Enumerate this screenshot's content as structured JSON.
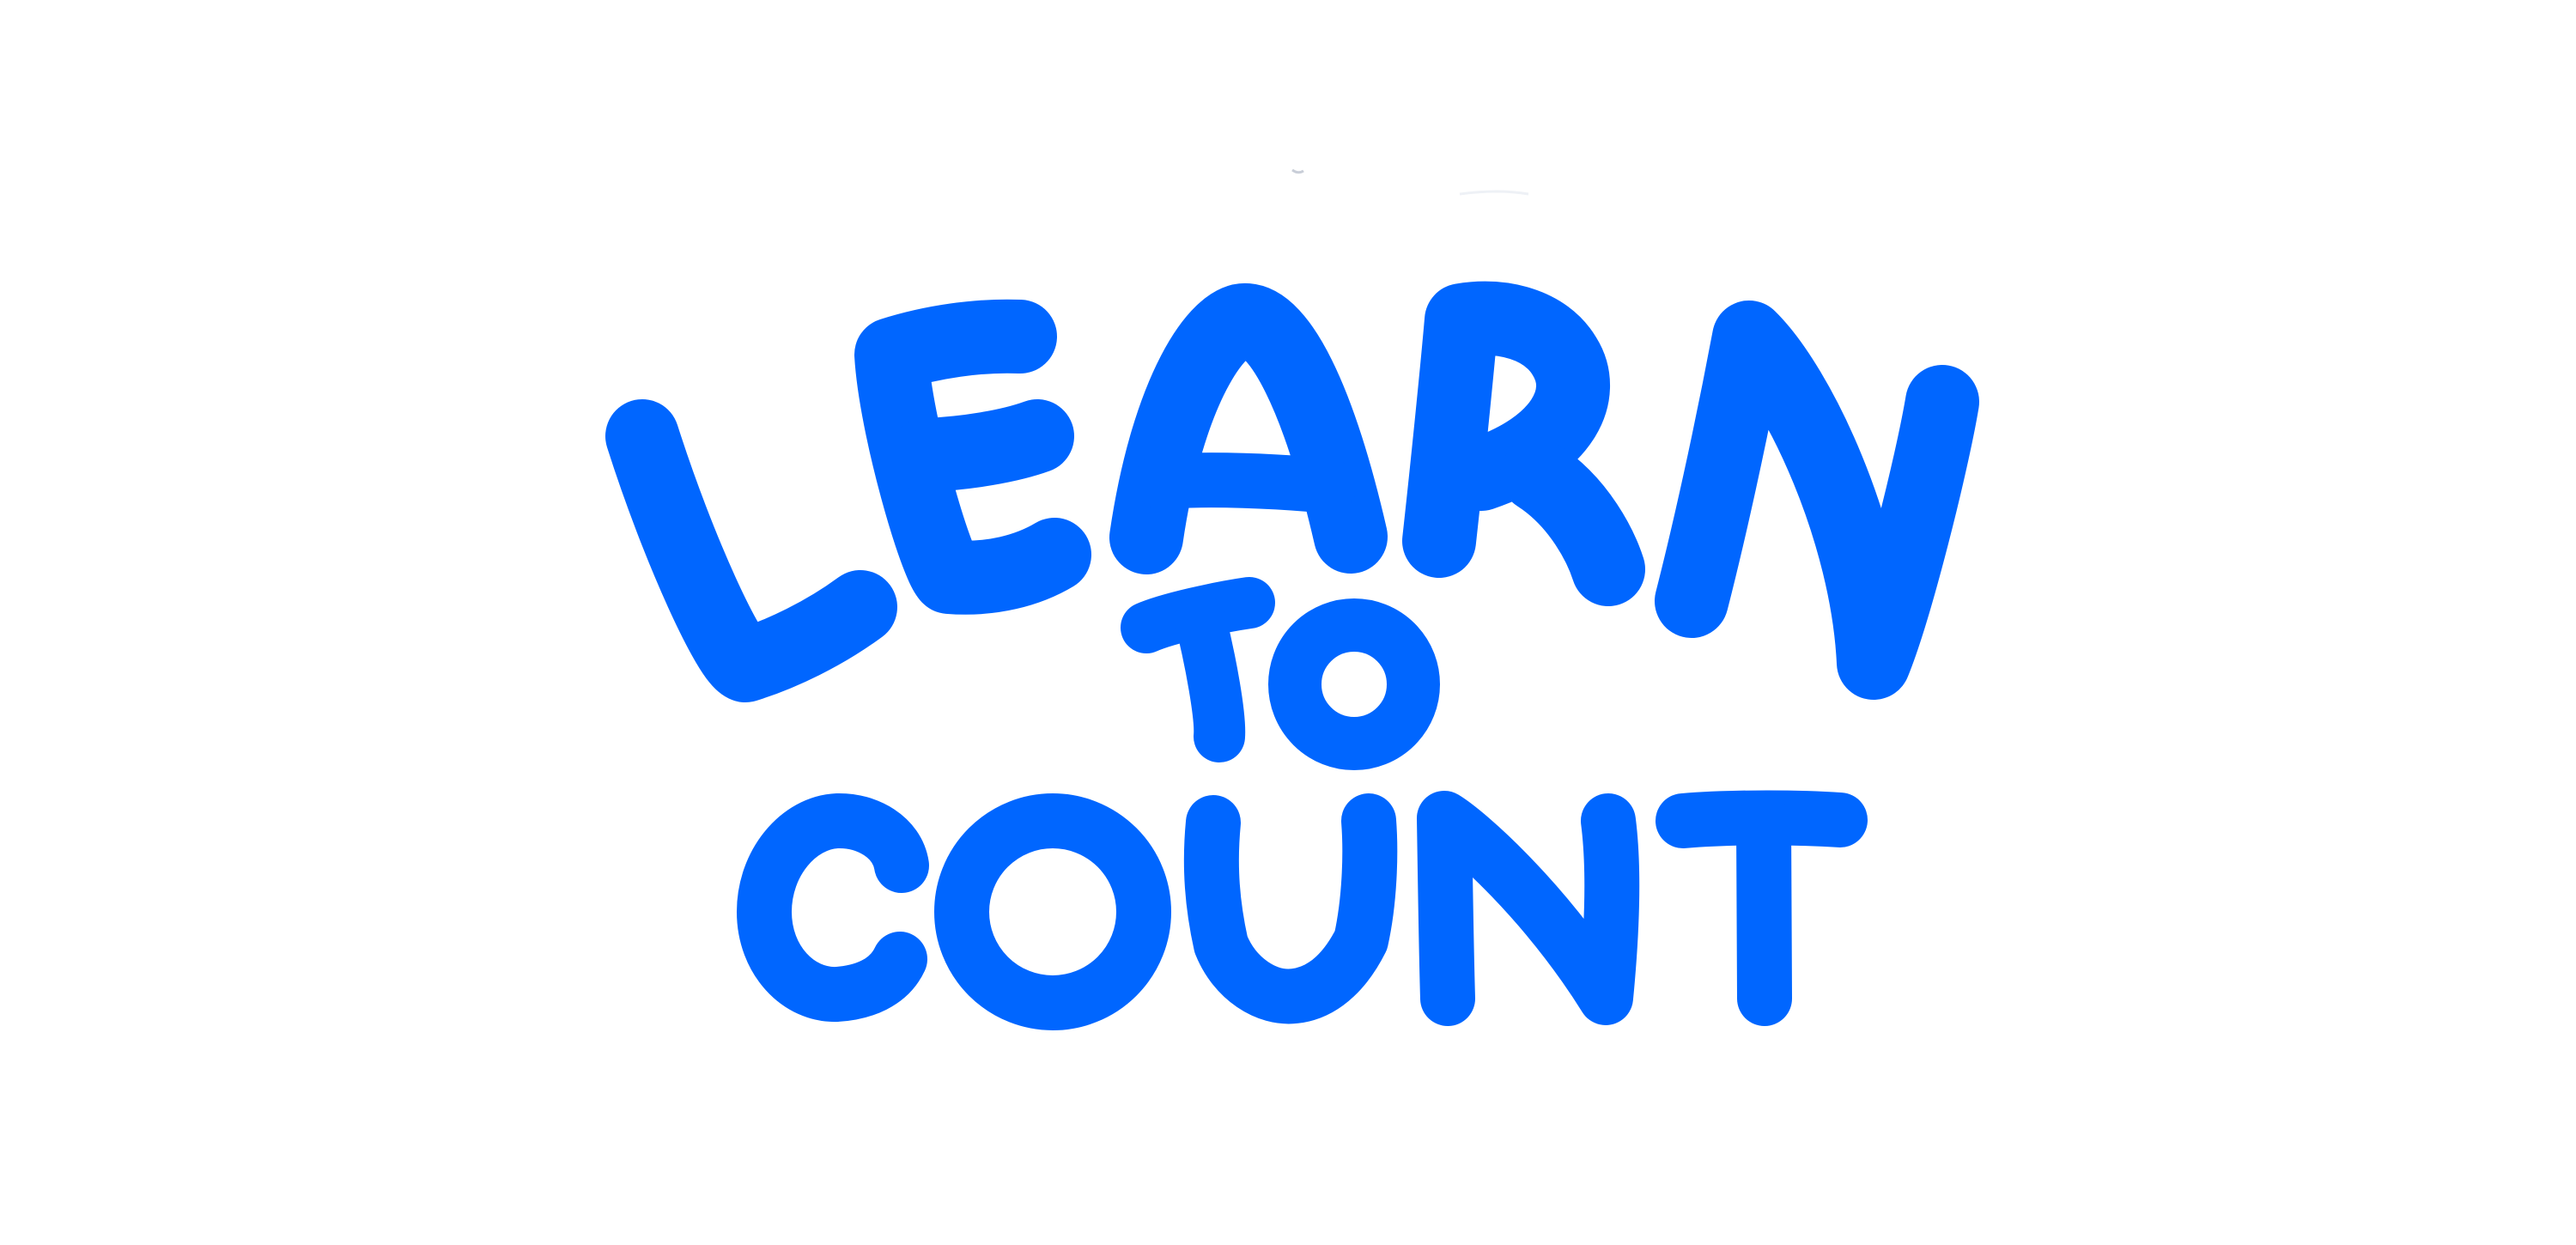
{
  "logo": {
    "line1": "LEARN",
    "line2": "TO",
    "line3": "COUNT",
    "color": "#0066FF"
  }
}
